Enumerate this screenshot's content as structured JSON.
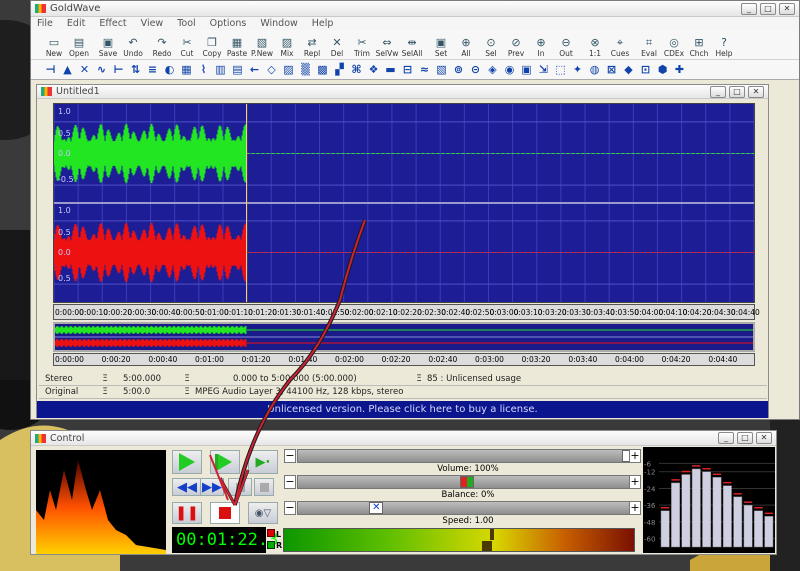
{
  "app": {
    "title": "GoldWave"
  },
  "menu": [
    "File",
    "Edit",
    "Effect",
    "View",
    "Tool",
    "Options",
    "Window",
    "Help"
  ],
  "toolbar": [
    {
      "label": "New",
      "icon": "new-icon"
    },
    {
      "label": "Open",
      "icon": "open-icon"
    },
    {
      "label": "Save",
      "icon": "save-icon"
    },
    {
      "label": "Undo",
      "icon": "undo-icon"
    },
    {
      "label": "Redo",
      "icon": "redo-icon"
    },
    {
      "label": "Cut",
      "icon": "cut-icon"
    },
    {
      "label": "Copy",
      "icon": "copy-icon"
    },
    {
      "label": "Paste",
      "icon": "paste-icon"
    },
    {
      "label": "P.New",
      "icon": "paste-new-icon"
    },
    {
      "label": "Mix",
      "icon": "mix-icon"
    },
    {
      "label": "Repl",
      "icon": "replace-icon"
    },
    {
      "label": "Del",
      "icon": "delete-icon"
    },
    {
      "label": "Trim",
      "icon": "trim-icon"
    },
    {
      "label": "SelVw",
      "icon": "select-view-icon"
    },
    {
      "label": "SelAll",
      "icon": "select-all-icon"
    },
    {
      "label": "Set",
      "icon": "set-icon"
    },
    {
      "label": "All",
      "icon": "zoom-all-icon"
    },
    {
      "label": "Sel",
      "icon": "zoom-selection-icon"
    },
    {
      "label": "Prev",
      "icon": "zoom-previous-icon"
    },
    {
      "label": "In",
      "icon": "zoom-in-icon"
    },
    {
      "label": "Out",
      "icon": "zoom-out-icon"
    },
    {
      "label": "1:1",
      "icon": "zoom-1to1-icon"
    },
    {
      "label": "Cues",
      "icon": "cues-icon"
    },
    {
      "label": "Eval",
      "icon": "evaluate-icon"
    },
    {
      "label": "CDEx",
      "icon": "cd-extract-icon"
    },
    {
      "label": "Chch",
      "icon": "chch-icon"
    },
    {
      "label": "Help",
      "icon": "help-icon"
    }
  ],
  "effects_toolbar_count": 38,
  "document": {
    "title": "Untitled1",
    "top_channel_labels": [
      "1.0",
      "0.5",
      "0.0",
      "-0.5"
    ],
    "bottom_channel_labels": [
      "1.0",
      "0.5",
      "0.0",
      "0.5"
    ],
    "ruler_ticks": [
      "0:00:00",
      "0:00:10",
      "0:00:20",
      "0:00:30",
      "0:00:40",
      "0:00:50",
      "0:01:00",
      "0:01:10",
      "0:01:20",
      "0:01:30",
      "0:01:40",
      "0:01:50",
      "0:02:00",
      "0:02:10",
      "0:02:20",
      "0:02:30",
      "0:02:40",
      "0:02:50",
      "0:03:00",
      "0:03:10",
      "0:03:20",
      "0:03:30",
      "0:03:40",
      "0:03:50",
      "0:04:00",
      "0:04:10",
      "0:04:20",
      "0:04:30",
      "0:04:40",
      "0:04:50"
    ],
    "overview_ticks": [
      "0:00:00",
      "0:00:20",
      "0:00:40",
      "0:01:00",
      "0:01:20",
      "0:01:40",
      "0:02:00",
      "0:02:20",
      "0:02:40",
      "0:03:00",
      "0:03:20",
      "0:03:40",
      "0:04:00",
      "0:04:20",
      "0:04:40"
    ],
    "recorded_fraction": 0.275,
    "status": {
      "row1": [
        "Stereo",
        "5:00.000",
        "0.000 to 5:00.000 (5:00.000)",
        "85 : Unlicensed usage"
      ],
      "row2": [
        "Original",
        "5:00.0",
        "MPEG Audio Layer 3, 44100 Hz, 128 kbps, stereo"
      ]
    },
    "license_text": "Unlicensed version. Please click here to buy a license."
  },
  "control": {
    "title": "Control",
    "time": "00:01:22.3",
    "volume_label": "Volume: 100%",
    "balance_label": "Balance: 0%",
    "speed_label": "Speed: 1.00",
    "volume_level": 1.0,
    "balance_level": 0.5,
    "speed_level": 0.22,
    "meter_axis": [
      "-6",
      "-12",
      "-24",
      "-36",
      "-48",
      "-60"
    ],
    "level_bars_db": [
      -40,
      -20,
      -14,
      -10,
      -12,
      -16,
      -22,
      -30,
      -36,
      -40,
      -44
    ]
  },
  "colors": {
    "wave_top": "#22e622",
    "wave_bottom": "#ee1111",
    "wave_bg": "#1d1d95",
    "license_bg": "#0b168e",
    "arrow": "#cc2233"
  }
}
